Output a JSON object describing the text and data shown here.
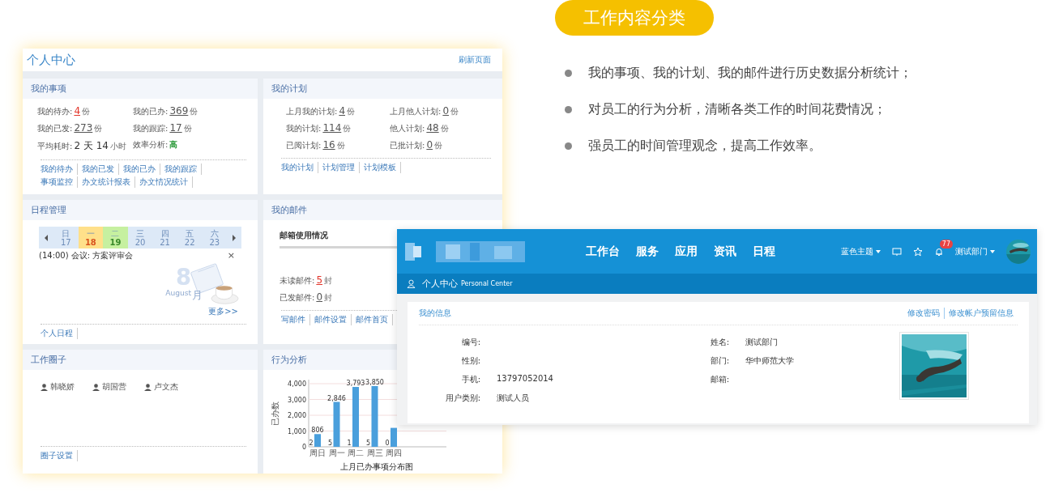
{
  "badge_title": "工作内容分类",
  "bullets": [
    "我的事项、我的计划、我的邮件进行历史数据分析统计；",
    "对员工的行为分析，清晰各类工作的时间花费情况；",
    "强员工的时间管理观念，提高工作效率。"
  ],
  "back_window": {
    "title": "个人中心",
    "refresh_link": "刷新页面",
    "panels": [
      {
        "kind": "stats",
        "title": "我的事项",
        "stats": [
          {
            "label": "我的待办:",
            "value": "4",
            "unit": "份",
            "kind": "alert"
          },
          {
            "label": "我的已办:",
            "value": "369",
            "unit": "份",
            "kind": "link"
          },
          {
            "label": "我的已发:",
            "value": "273",
            "unit": "份",
            "kind": "link"
          },
          {
            "label": "我的跟踪:",
            "value": "17",
            "unit": "份",
            "kind": "link"
          },
          {
            "label": "平均耗时:",
            "value": "2 天 14",
            "unit": "小时",
            "kind": "plain"
          },
          {
            "label": "效率分析:",
            "value": "高",
            "kind": "good"
          }
        ],
        "links": [
          "我的待办",
          "我的已发",
          "我的已办",
          "我的跟踪",
          "事项监控",
          "办文统计报表",
          "办文情况统计"
        ]
      },
      {
        "kind": "stats",
        "title": "我的计划",
        "stats": [
          {
            "label": "上月我的计划:",
            "value": "4",
            "unit": "份",
            "kind": "link"
          },
          {
            "label": "上月他人计划:",
            "value": "0",
            "unit": "份",
            "kind": "link"
          },
          {
            "label": "我的计划:",
            "value": "114",
            "unit": "份",
            "kind": "link"
          },
          {
            "label": "他人计划:",
            "value": "48",
            "unit": "份",
            "kind": "link"
          },
          {
            "label": "已阅计划:",
            "value": "16",
            "unit": "份",
            "kind": "link"
          },
          {
            "label": "已批计划:",
            "value": "0",
            "unit": "份",
            "kind": "link"
          }
        ],
        "links": [
          "我的计划",
          "计划管理",
          "计划模板"
        ]
      },
      {
        "kind": "calendar",
        "title": "日程管理",
        "days": [
          {
            "weekday": "日",
            "date": "17"
          },
          {
            "weekday": "一",
            "date": "18",
            "color": "#ffe08a"
          },
          {
            "weekday": "二",
            "date": "19",
            "color": "#c6f0a0"
          },
          {
            "weekday": "三",
            "date": "20"
          },
          {
            "weekday": "四",
            "date": "21"
          },
          {
            "weekday": "五",
            "date": "22"
          },
          {
            "weekday": "六",
            "date": "23"
          }
        ],
        "event": "(14:00) 会议: 方案评审会",
        "close": "×",
        "illustration": {
          "digit": "8",
          "month_en": "August",
          "month_cn": "月"
        },
        "more_link": "更多>>",
        "links": [
          "个人日程"
        ]
      },
      {
        "kind": "mail",
        "title": "我的邮件",
        "usage_label": "邮箱使用情况",
        "stats": [
          {
            "label": "未读邮件:",
            "value": "5",
            "unit": "封",
            "kind": "alert"
          },
          {
            "label": "已发邮件:",
            "value": "0",
            "unit": "封",
            "kind": "link"
          }
        ],
        "links": [
          "写邮件",
          "邮件设置",
          "邮件首页"
        ]
      },
      {
        "kind": "circle",
        "title": "工作圈子",
        "members": [
          "韩晓娇",
          "胡国营",
          "卢文杰"
        ],
        "links": [
          "圈子设置"
        ]
      },
      {
        "kind": "chart",
        "title": "行为分析",
        "chart_data": {
          "type": "bar",
          "title": "上月已办事项分布图",
          "ylabel": "已办数",
          "categories": [
            "周日",
            "周一",
            "周二",
            "周三",
            "周四"
          ],
          "values": [
            806,
            2846,
            3793,
            3850,
            1200
          ],
          "grid": true,
          "ylim": [
            0,
            4000
          ],
          "yticks": [
            {
              "value": 0,
              "label": "0"
            },
            {
              "value": 1000,
              "label": "1,000"
            },
            {
              "value": 2000,
              "label": "2,000"
            },
            {
              "value": 3000,
              "label": "3,000"
            },
            {
              "value": 4000,
              "label": "4,000"
            }
          ],
          "annotations": [
            {
              "x": "周日",
              "y": 806,
              "text": "806"
            },
            {
              "x": "周一",
              "y": 2846,
              "text": "2,846"
            },
            {
              "x": "周二",
              "y": 3793,
              "text": "3,793"
            },
            {
              "x": "周三",
              "y": 3850,
              "text": "3,850"
            },
            {
              "x": "周日",
              "y": 0,
              "text": "2"
            },
            {
              "x": "周一",
              "y": 0,
              "text": "5"
            },
            {
              "x": "周二",
              "y": 0,
              "text": "1"
            },
            {
              "x": "周三",
              "y": 0,
              "text": "5"
            },
            {
              "x": "周四",
              "y": 0,
              "text": "0"
            }
          ]
        }
      }
    ]
  },
  "front_window": {
    "nav": [
      "工作台",
      "服务",
      "应用",
      "资讯",
      "日程"
    ],
    "theme_menu": "蓝色主题",
    "notification_count": "77",
    "user_menu": "测试部门",
    "subbar_title": "个人中心",
    "subbar_subtitle": "Personal Center",
    "card_title": "我的信息",
    "actions": [
      "修改密码",
      "修改帐户预留信息"
    ],
    "fields": [
      {
        "label": "编号:"
      },
      {
        "label": "姓名:",
        "value": "测试部门"
      },
      {
        "label": "性别:"
      },
      {
        "label": "部门:",
        "value": "华中师范大学"
      },
      {
        "label": "手机:",
        "value": "13797052014"
      },
      {
        "label": "邮箱:"
      },
      {
        "label": "用户类别:",
        "value": "测试人员"
      }
    ]
  }
}
